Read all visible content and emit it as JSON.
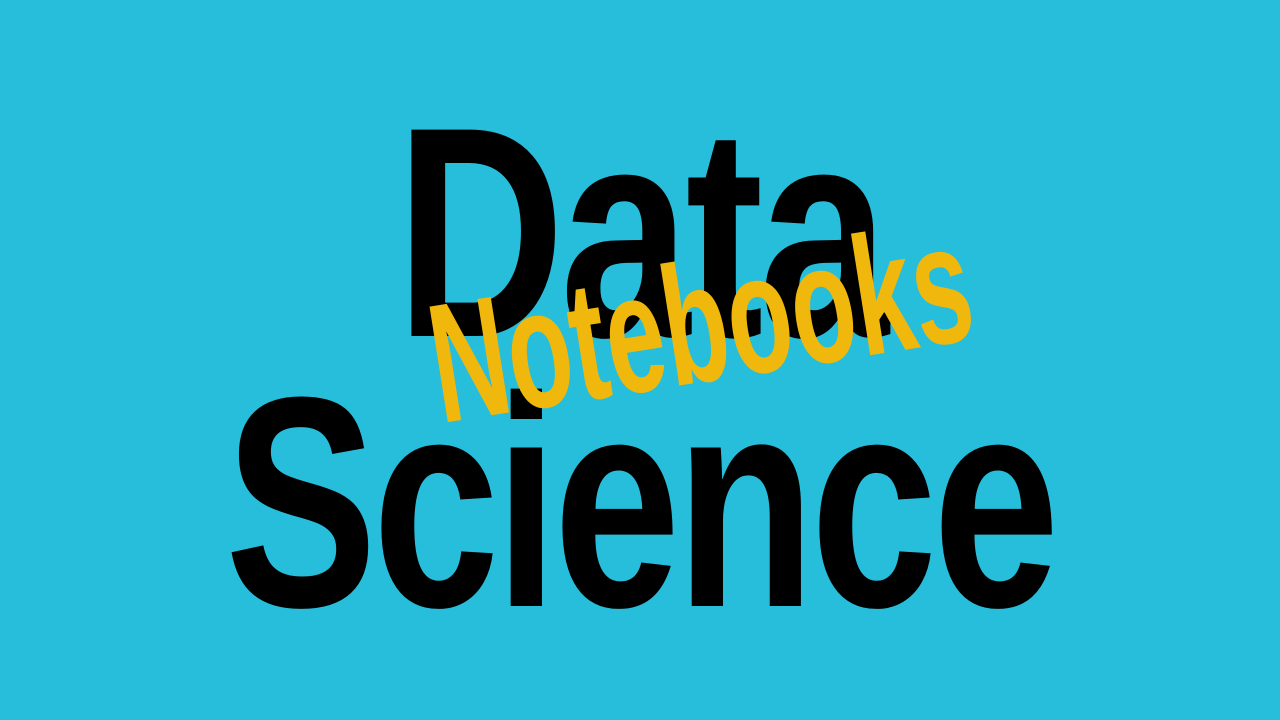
{
  "title": {
    "line1": "Data",
    "line2": "Science",
    "overlay": "Notebooks"
  },
  "colors": {
    "background": "#26BEDB",
    "primary_text": "#000000",
    "overlay_text": "#F0B80C"
  }
}
